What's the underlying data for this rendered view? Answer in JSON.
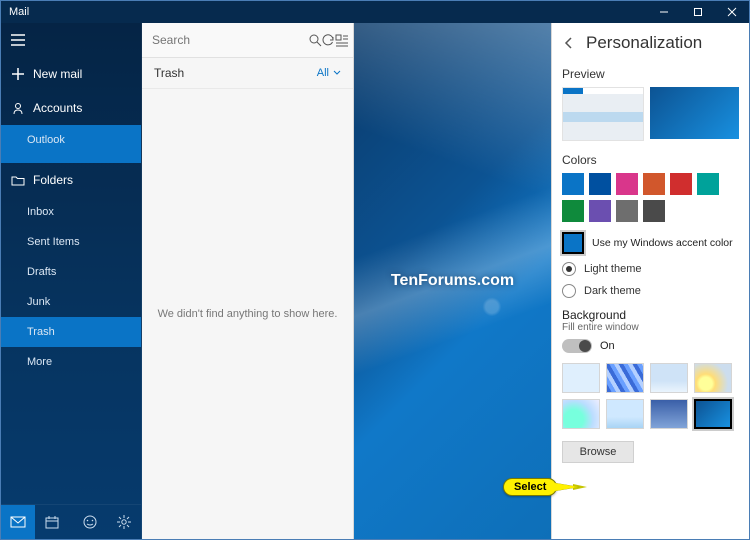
{
  "titlebar": {
    "app_name": "Mail"
  },
  "sidebar": {
    "new_mail": "New mail",
    "accounts_label": "Accounts",
    "accounts": [
      {
        "name": "Outlook"
      }
    ],
    "folders_label": "Folders",
    "folders": [
      {
        "name": "Inbox"
      },
      {
        "name": "Sent Items"
      },
      {
        "name": "Drafts"
      },
      {
        "name": "Junk"
      },
      {
        "name": "Trash"
      },
      {
        "name": "More"
      }
    ],
    "selected_folder_index": 4
  },
  "list": {
    "search_placeholder": "Search",
    "header_title": "Trash",
    "filter_label": "All",
    "empty_text": "We didn't find anything to show here."
  },
  "watermark": "TenForums.com",
  "panel": {
    "title": "Personalization",
    "preview_label": "Preview",
    "colors_label": "Colors",
    "colors": [
      "#0a74c6",
      "#0050a0",
      "#d9368b",
      "#d1572c",
      "#d02e2e",
      "#00a29a",
      "#0f8a3c",
      "#6b4fb0",
      "#6e6e6e",
      "#4a4a4a"
    ],
    "accent_label": "Use my Windows accent color",
    "accent_color": "#0a74c6",
    "theme_light": "Light theme",
    "theme_dark": "Dark theme",
    "theme_selected": "light",
    "background_label": "Background",
    "fill_label": "Fill entire window",
    "toggle_state": "On",
    "selected_thumb_index": 7,
    "browse_label": "Browse"
  },
  "callout": {
    "text": "Select"
  }
}
